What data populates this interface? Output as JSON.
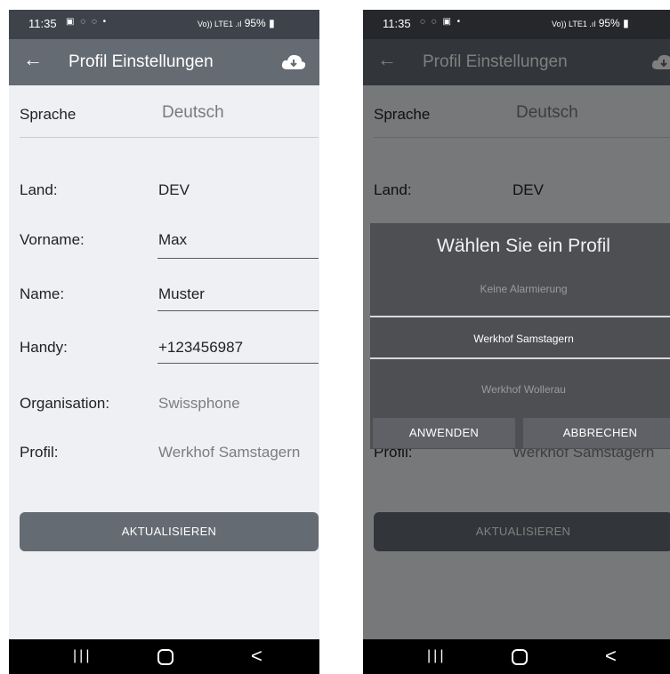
{
  "status_bar": {
    "time": "11:35",
    "battery": "95%",
    "network": "Vo)) LTE1 .ıl"
  },
  "app_bar": {
    "title": "Profil Einstellungen",
    "back_icon": "arrow-left-icon",
    "cloud_icon": "cloud-download-icon"
  },
  "form": {
    "language_label": "Sprache",
    "language_value": "Deutsch",
    "country_label": "Land:",
    "country_value": "DEV",
    "firstname_label": "Vorname:",
    "firstname_value": "Max",
    "lastname_label": "Name:",
    "lastname_value": "Muster",
    "mobile_label": "Handy:",
    "mobile_value": "+123456987",
    "org_label": "Organisation:",
    "org_value": "Swissphone",
    "profile_label": "Profil:",
    "profile_value": "Werkhof Samstagern"
  },
  "update_button": "AKTUALISIEREN",
  "dialog": {
    "title": "Wählen Sie ein Profil",
    "options": [
      "Keine Alarmierung",
      "Werkhof Samstagern",
      "Werkhof Wollerau"
    ],
    "selected": "Werkhof Samstagern",
    "apply_button": "ANWENDEN",
    "cancel_button": "ABBRECHEN"
  },
  "nav_bar": {
    "recent_icon": "|||",
    "home_icon": "home-icon",
    "back_icon": "<"
  }
}
